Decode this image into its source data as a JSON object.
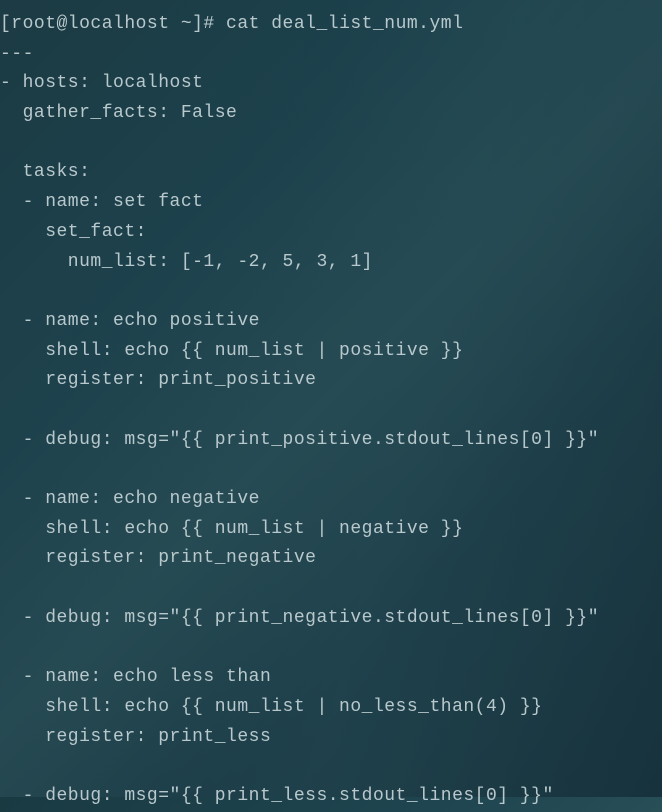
{
  "terminal": {
    "prompt": "[root@localhost ~]# ",
    "command": "cat deal_list_num.yml",
    "yaml": {
      "doc_start": "---",
      "hosts_line": "- hosts: localhost",
      "gather_facts_line": "  gather_facts: False",
      "tasks_line": "  tasks:",
      "task1_name": "  - name: set fact",
      "task1_setfact": "    set_fact:",
      "task1_numlist": "      num_list: [-1, -2, 5, 3, 1]",
      "task2_name": "  - name: echo positive",
      "task2_shell": "    shell: echo {{ num_list | positive }}",
      "task2_register": "    register: print_positive",
      "task3_debug": "  - debug: msg=\"{{ print_positive.stdout_lines[0] }}\"",
      "task4_name": "  - name: echo negative",
      "task4_shell": "    shell: echo {{ num_list | negative }}",
      "task4_register": "    register: print_negative",
      "task5_debug": "  - debug: msg=\"{{ print_negative.stdout_lines[0] }}\"",
      "task6_name": "  - name: echo less than",
      "task6_shell": "    shell: echo {{ num_list | no_less_than(4) }}",
      "task6_register": "    register: print_less",
      "task7_debug": "  - debug: msg=\"{{ print_less.stdout_lines[0] }}\""
    }
  }
}
